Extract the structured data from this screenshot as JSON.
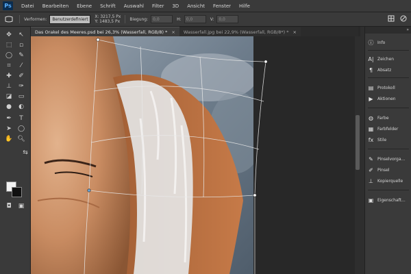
{
  "app": {
    "logo": "Ps"
  },
  "menu": [
    "Datei",
    "Bearbeiten",
    "Ebene",
    "Schrift",
    "Auswahl",
    "Filter",
    "3D",
    "Ansicht",
    "Fenster",
    "Hilfe"
  ],
  "options": {
    "warp_label": "Verformen:",
    "warp_value": "Benutzerdefiniert",
    "x_value": "X: 3217,5 Px",
    "y_value": "Y: 1483,5 Px",
    "bend_label": "Biegung:",
    "bend_value": "0,0",
    "h_label": "H:",
    "h_value": "0,0",
    "v_label": "V:",
    "v_value": "0,0"
  },
  "tabs": [
    {
      "label": "Das Orakel des Meeres.psd bei 26,3% (Wasserfall, RGB/8) *",
      "active": true
    },
    {
      "label": "Wasserfall.jpg bei 22,9% (Wasserfall, RGB/8*) *",
      "active": false
    }
  ],
  "panels": [
    {
      "label": "Info",
      "icon": "info-icon"
    },
    {
      "label": "Zeichen",
      "icon": "character-icon"
    },
    {
      "label": "Absatz",
      "icon": "paragraph-icon"
    },
    {
      "label": "Protokoll",
      "icon": "history-icon"
    },
    {
      "label": "Aktionen",
      "icon": "actions-icon"
    },
    {
      "label": "Farbe",
      "icon": "color-icon"
    },
    {
      "label": "Farbfelder",
      "icon": "swatches-icon"
    },
    {
      "label": "Stile",
      "icon": "styles-icon"
    },
    {
      "label": "Pinselvorga...",
      "icon": "brush-presets-icon"
    },
    {
      "label": "Pinsel",
      "icon": "brush-icon"
    },
    {
      "label": "Kopierquelle",
      "icon": "clone-source-icon"
    },
    {
      "label": "Eigenschaft...",
      "icon": "properties-icon"
    }
  ],
  "colors": {
    "foreground": "#f2f2f2",
    "background": "#111111",
    "accent": "#5ab0ff"
  }
}
